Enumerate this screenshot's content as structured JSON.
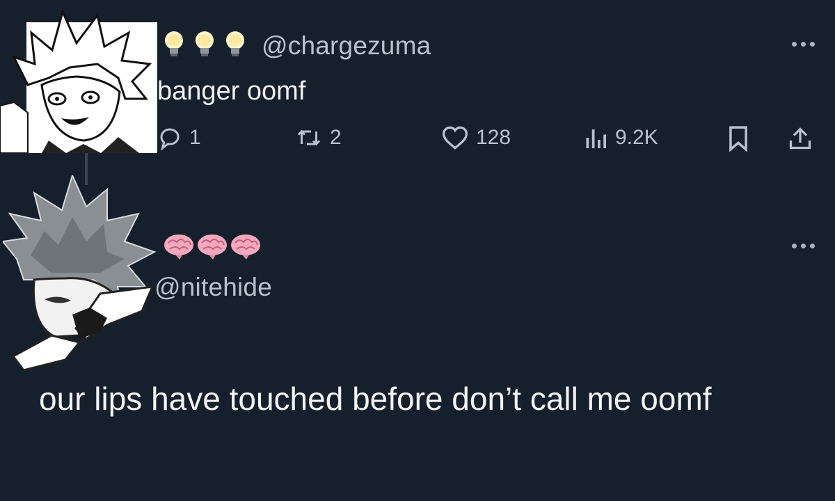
{
  "reply_tweet": {
    "header_emojis": [
      "lightbulb-icon",
      "lightbulb-icon",
      "lightbulb-icon"
    ],
    "handle": "@chargezuma",
    "text": "banger oomf",
    "actions": {
      "replies": "1",
      "retweets": "2",
      "likes": "128",
      "views": "9.2K"
    }
  },
  "original_tweet": {
    "header_emojis": [
      "brain-icon",
      "brain-icon",
      "brain-icon"
    ],
    "handle": "@nitehide",
    "text": "our lips have touched before don’t call me oomf"
  },
  "colors": {
    "background": "#16202c",
    "text_primary": "#f3f5f7",
    "text_secondary": "#b9c2cc"
  }
}
